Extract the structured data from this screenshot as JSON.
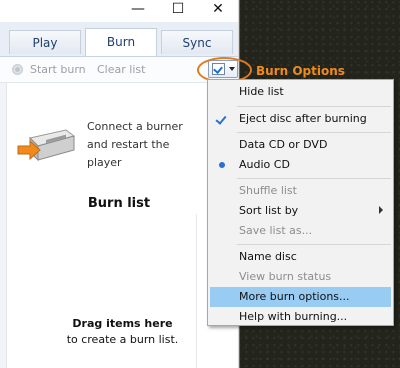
{
  "window": {
    "controls": {
      "minimize": "—",
      "maximize": "☐",
      "close": "✕"
    }
  },
  "tabs": [
    {
      "label": "Play"
    },
    {
      "label": "Burn"
    },
    {
      "label": "Sync"
    }
  ],
  "toolbar": {
    "start_burn": "Start burn",
    "clear_list": "Clear list"
  },
  "annotation": {
    "label": "Burn Options",
    "color": "#f08a1c"
  },
  "burner": {
    "message": "Connect a burner and restart the player"
  },
  "burn_list": {
    "title": "Burn list",
    "drag_hint_bold": "Drag items here",
    "drag_hint": "to create a burn list."
  },
  "menu": {
    "items": [
      {
        "label": "Hide list",
        "state": "normal"
      },
      {
        "label": "Eject disc after burning",
        "state": "checked"
      },
      {
        "label": "Data CD or DVD",
        "state": "normal"
      },
      {
        "label": "Audio CD",
        "state": "selected"
      },
      {
        "label": "Shuffle list",
        "state": "disabled"
      },
      {
        "label": "Sort list by",
        "state": "submenu"
      },
      {
        "label": "Save list as...",
        "state": "disabled"
      },
      {
        "label": "Name disc",
        "state": "normal"
      },
      {
        "label": "View burn status",
        "state": "disabled"
      },
      {
        "label": "More burn options...",
        "state": "highlighted"
      },
      {
        "label": "Help with burning...",
        "state": "normal"
      }
    ]
  }
}
